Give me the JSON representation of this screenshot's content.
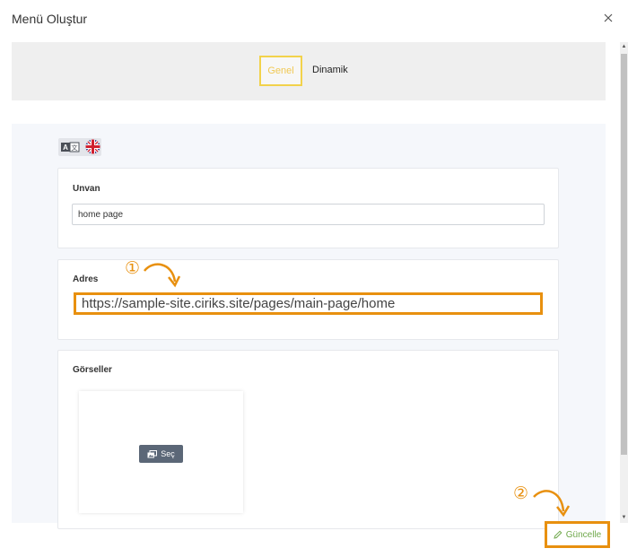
{
  "dialog": {
    "title": "Menü Oluştur"
  },
  "tabs": [
    {
      "label": "Genel",
      "active": true
    },
    {
      "label": "Dinamik",
      "active": false
    }
  ],
  "language_icons": [
    "translate-icon",
    "uk-flag-icon"
  ],
  "fields": {
    "unvan_label": "Unvan",
    "unvan_value": "home page",
    "adres_label": "Adres",
    "adres_value": "https://sample-site.ciriks.site/pages/main-page/home",
    "gorseller_label": "Görseller"
  },
  "image_picker": {
    "button_label": "Seç",
    "icon": "images-icon"
  },
  "footer": {
    "update_label": "Güncelle",
    "update_icon": "pencil-icon"
  },
  "annotations": {
    "marker_1": "①",
    "marker_2": "②",
    "highlight_color": "#e8900f"
  },
  "colors": {
    "active_tab_border": "#f2d24b",
    "update_text": "#6fa84b",
    "button_dark": "#5b6777"
  }
}
